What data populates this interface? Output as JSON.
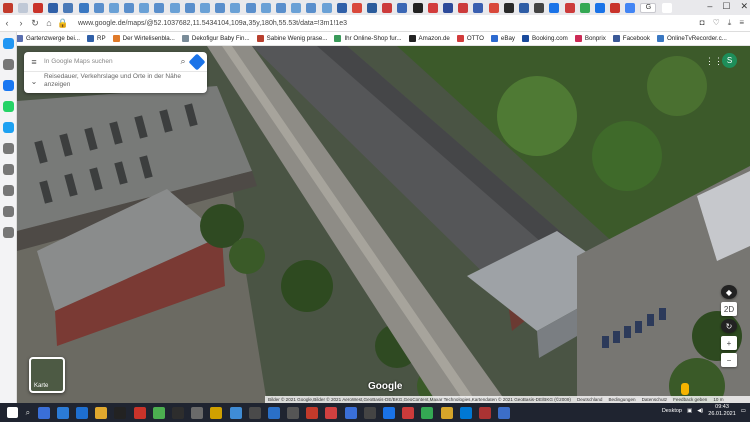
{
  "browser": {
    "url": "www.google.de/maps/@52.1037682,11.5434104,109a,35y,180h,55.53t/data=!3m1!1e3",
    "active_tab_label": "G",
    "window_controls": [
      "–",
      "☐",
      "✕"
    ],
    "tab_colors": [
      "#c23a2b",
      "#bfc8d6",
      "#c9332a",
      "#3060a8",
      "#4a7ab8",
      "#3a78c2",
      "#5a8fcc",
      "#6aa1d6",
      "#5a8fcc",
      "#6aa1d6",
      "#5a8fcc",
      "#6aa1d6",
      "#5a8fcc",
      "#6aa1d6",
      "#5a8fcc",
      "#6aa1d6",
      "#5a8fcc",
      "#6aa1d6",
      "#5a8fcc",
      "#6aa1d6",
      "#5a8fcc",
      "#6aa1d6",
      "#3060a8",
      "#d9483b",
      "#2b5c9c",
      "#cc3b3b",
      "#3b67b5",
      "#222222",
      "#d23c3c",
      "#2d4a9a",
      "#cc3b3b",
      "#3a5fb0",
      "#d9483b",
      "#2a2a2a",
      "#2f5da6",
      "#444444",
      "#1a73e8",
      "#cc3b3b",
      "#34a853",
      "#1a73e8",
      "#c9332a",
      "#4285f4",
      "#ffffff"
    ]
  },
  "bookmarks": [
    {
      "label": "Gartenzwerge bei...",
      "color": "#5a6fb0"
    },
    {
      "label": "RP",
      "color": "#3060a8"
    },
    {
      "label": "Der Wirtelisenbla...",
      "color": "#e07a2a"
    },
    {
      "label": "Dekofigur Baby Fin...",
      "color": "#7a8c99"
    },
    {
      "label": "Sabine Wenig prase...",
      "color": "#b8402f"
    },
    {
      "label": "Ihr Online-Shop fur...",
      "color": "#3a9a5a"
    },
    {
      "label": "Amazon.de",
      "color": "#222222"
    },
    {
      "label": "OTTO",
      "color": "#d23c3c"
    },
    {
      "label": "eBay",
      "color": "#2d6ad0"
    },
    {
      "label": "Booking.com",
      "color": "#1a4a9c"
    },
    {
      "label": "Bonprix",
      "color": "#cc2a55"
    },
    {
      "label": "Facebook",
      "color": "#3b5998"
    },
    {
      "label": "OnlineTvRecorder.c...",
      "color": "#3a78c2"
    }
  ],
  "sidebar_icons": [
    {
      "name": "speed-dial-icon",
      "color": "#2196f3"
    },
    {
      "name": "bag-icon",
      "color": "#777777"
    },
    {
      "name": "messenger-icon",
      "color": "#1877f2"
    },
    {
      "name": "whatsapp-icon",
      "color": "#25d366"
    },
    {
      "name": "twitter-icon",
      "color": "#1da1f2"
    },
    {
      "name": "heart-icon",
      "color": "#777777"
    },
    {
      "name": "history-icon",
      "color": "#777777"
    },
    {
      "name": "download-icon",
      "color": "#777777"
    },
    {
      "name": "cube-icon",
      "color": "#777777"
    },
    {
      "name": "settings-icon",
      "color": "#777777"
    }
  ],
  "maps": {
    "search_placeholder": "In Google Maps suchen",
    "suggestion_text": "Reisedauer, Verkehrslage und Orte in der Nähe anzeigen",
    "layer_label": "Karte",
    "logo": "Google",
    "avatar_letter": "S",
    "footer": [
      "Bilder © 2021 Google,Bilder © 2021 AeroWest,GeoBasis-DE/BKG,GeoContent,Maxar Technologies,Kartendaten © 2021 GeoBasis-DE/BKG (©2009)",
      "Deutschland",
      "Bedingungen",
      "Datenschutz",
      "Feedback geben",
      "10 m"
    ],
    "zoom_in": "+",
    "zoom_out": "−",
    "tilt_label": "2D",
    "scale": "10 m"
  },
  "taskbar": {
    "icons": [
      "#3a6fd8",
      "#2b7bd6",
      "#1e6fd0",
      "#e0a82e",
      "#222",
      "#c9332a",
      "#4caf50",
      "#2d2d2d",
      "#6a6a6a",
      "#d0a000",
      "#3f8cd6",
      "#4a4a4a",
      "#2a70c8",
      "#555",
      "#c23a2b",
      "#d04040",
      "#3a6fd8",
      "#444",
      "#1a73e8",
      "#cc3b3b",
      "#34a853",
      "#d6a52a",
      "#0078d4",
      "#aa3333",
      "#3c6ec8"
    ],
    "desktop_label": "Desktop",
    "time": "09:43",
    "date": "26.01.2021"
  }
}
